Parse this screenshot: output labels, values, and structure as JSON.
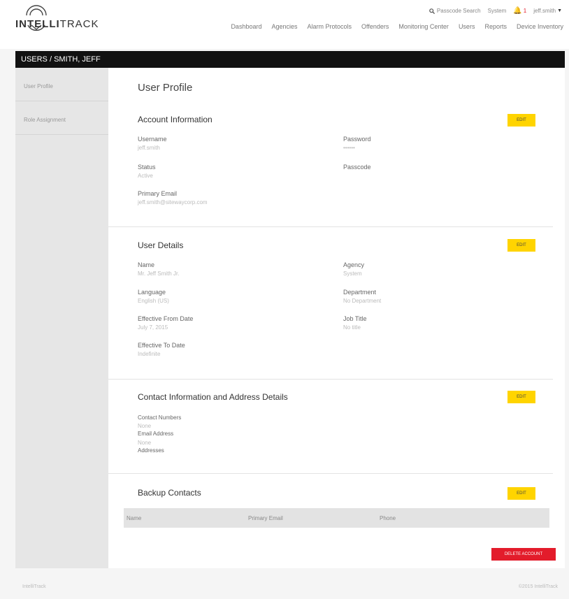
{
  "brand": {
    "name_bold": "INTELLI",
    "name_rest": "TRACK"
  },
  "topbar": {
    "search": "Passcode Search",
    "system": "System",
    "alert_count": "1",
    "user": "jeff.smith"
  },
  "nav": [
    "Dashboard",
    "Agencies",
    "Alarm Protocols",
    "Offenders",
    "Monitoring Center",
    "Users",
    "Reports",
    "Device Inventory"
  ],
  "breadcrumb": "USERS / SMITH, JEFF",
  "sidebar": [
    "User Profile",
    "Role Assignment"
  ],
  "page_title": "User Profile",
  "edit_label": "EDIT",
  "account": {
    "title": "Account Information",
    "fields": [
      {
        "label": "Username",
        "value": "jeff.smith"
      },
      {
        "label": "Password",
        "value": "••••••"
      },
      {
        "label": "Status",
        "value": "Active"
      },
      {
        "label": "Passcode",
        "value": ""
      },
      {
        "label": "Primary Email",
        "value": "jeff.smith@sitewaycorp.com"
      }
    ]
  },
  "details": {
    "title": "User Details",
    "fields": [
      {
        "label": "Name",
        "value": "Mr. Jeff Smith Jr."
      },
      {
        "label": "Agency",
        "value": "System"
      },
      {
        "label": "Language",
        "value": "English (US)"
      },
      {
        "label": "Department",
        "value": "No Department"
      },
      {
        "label": "Effective From Date",
        "value": "July 7, 2015"
      },
      {
        "label": "Job Title",
        "value": "No title"
      },
      {
        "label": "Effective To Date",
        "value": "Indefinite"
      }
    ]
  },
  "contact": {
    "title": "Contact Information and Address Details",
    "contact_numbers_label": "Contact Numbers",
    "contact_numbers_value": "None",
    "email_label": "Email Address",
    "email_value": "None",
    "addresses_label": "Addresses"
  },
  "backup": {
    "title": "Backup Contacts",
    "columns": [
      "Name",
      "Primary Email",
      "Phone"
    ]
  },
  "delete_label": "DELETE ACCOUNT",
  "footer": {
    "left": "IntelliTrack",
    "right": "©2015 IntelliTrack"
  }
}
